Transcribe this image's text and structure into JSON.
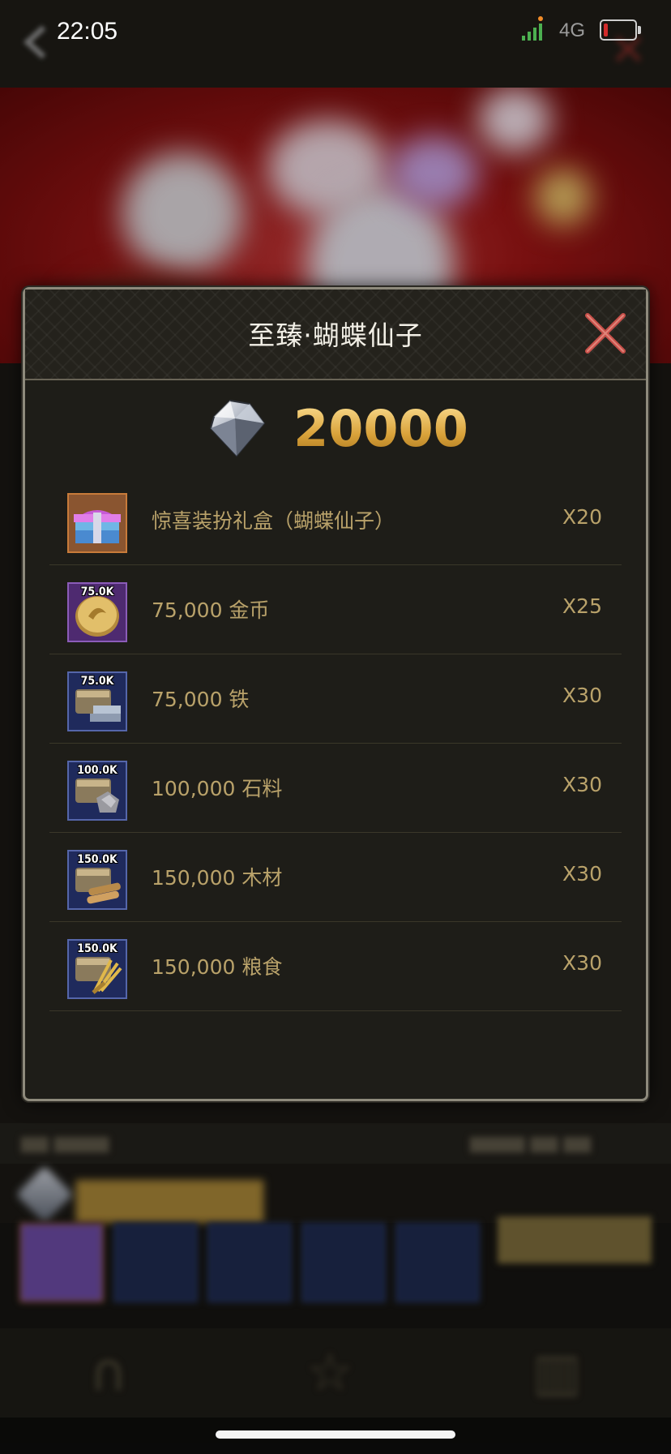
{
  "status_bar": {
    "time": "22:05",
    "network": "4G",
    "battery_level": 0.15,
    "battery_color": "#d12b2b"
  },
  "modal": {
    "title": "至臻·蝴蝶仙子",
    "close_icon": "close-x-icon",
    "price": {
      "icon": "diamond-icon",
      "value": "20000"
    },
    "items": [
      {
        "icon": "pink-treasure-chest-icon",
        "badge": "",
        "name": "惊喜装扮礼盒（蝴蝶仙子）",
        "qty": "X20"
      },
      {
        "icon": "gold-coin-icon",
        "badge": "75.0K",
        "name": "75,000 金币",
        "qty": "X25"
      },
      {
        "icon": "iron-chest-icon",
        "badge": "75.0K",
        "name": "75,000 铁",
        "qty": "X30"
      },
      {
        "icon": "stone-chest-icon",
        "badge": "100.0K",
        "name": "100,000 石料",
        "qty": "X30"
      },
      {
        "icon": "wood-chest-icon",
        "badge": "150.0K",
        "name": "150,000 木材",
        "qty": "X30"
      },
      {
        "icon": "food-chest-icon",
        "badge": "150.0K",
        "name": "150,000 粮食",
        "qty": "X30"
      }
    ]
  },
  "colors": {
    "accent_gold": "#b9a26a",
    "price_gold": "#e0b04a",
    "close_red": "#c8504a"
  }
}
